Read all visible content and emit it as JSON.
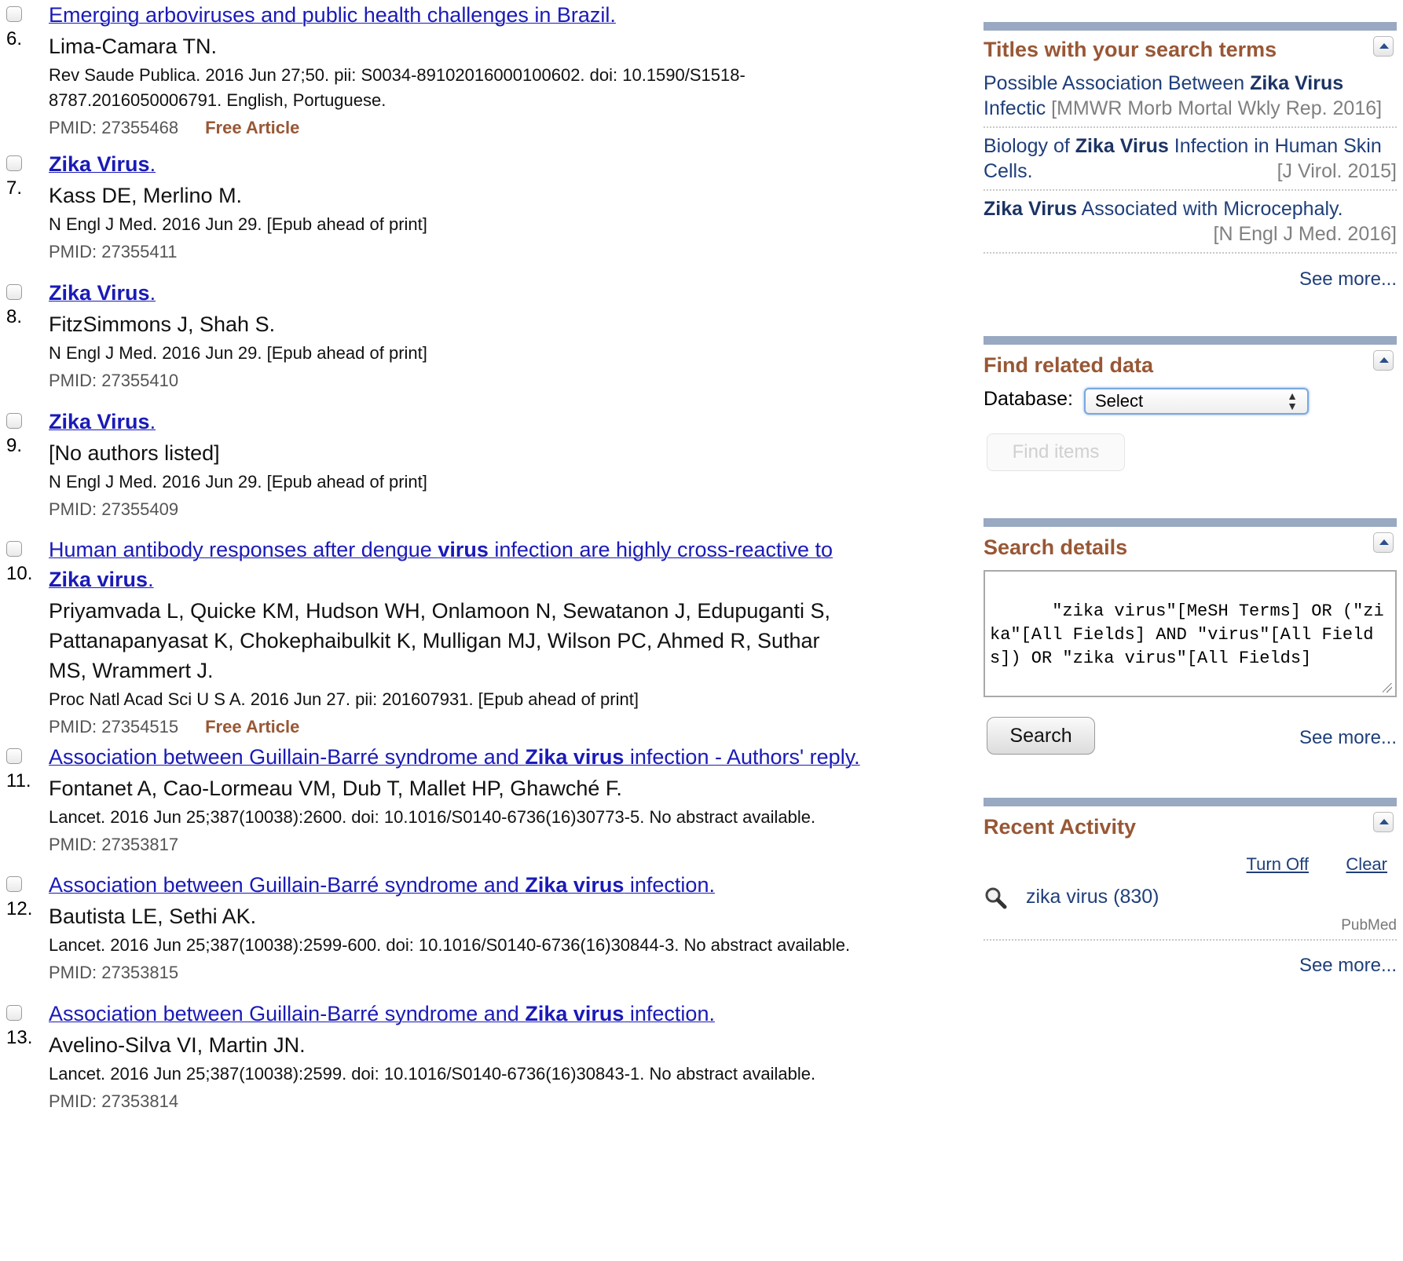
{
  "results": [
    {
      "number": "6.",
      "title_html": "Emerging arboviruses and public health challenges in Brazil.",
      "authors": "Lima-Camara TN.",
      "details": "Rev Saude Publica. 2016 Jun 27;50. pii: S0034-89102016000100602. doi: 10.1590/S1518-8787.2016050006791. English, Portuguese.",
      "pmid": "PMID: 27355468",
      "free": "Free Article"
    },
    {
      "number": "7.",
      "title_html": "<b>Zika Virus</b>.",
      "authors": "Kass DE, Merlino M.",
      "details": "N Engl J Med. 2016 Jun 29. [Epub ahead of print]",
      "pmid": "PMID: 27355411",
      "free": ""
    },
    {
      "number": "8.",
      "title_html": "<b>Zika Virus</b>.",
      "authors": "FitzSimmons J, Shah S.",
      "details": "N Engl J Med. 2016 Jun 29. [Epub ahead of print]",
      "pmid": "PMID: 27355410",
      "free": ""
    },
    {
      "number": "9.",
      "title_html": "<b>Zika Virus</b>.",
      "authors": "[No authors listed]",
      "details": "N Engl J Med. 2016 Jun 29. [Epub ahead of print]",
      "pmid": "PMID: 27355409",
      "free": ""
    },
    {
      "number": "10.",
      "title_html": "Human antibody responses after dengue <b>virus</b> infection are highly cross-reactive to <b>Zika virus</b>.",
      "authors": "Priyamvada L, Quicke KM, Hudson WH, Onlamoon N, Sewatanon J, Edupuganti S, Pattanapanyasat K, Chokephaibulkit K, Mulligan MJ, Wilson PC, Ahmed R, Suthar MS, Wrammert J.",
      "details": "Proc Natl Acad Sci U S A. 2016 Jun 27. pii: 201607931. [Epub ahead of print]",
      "pmid": "PMID: 27354515",
      "free": "Free Article"
    },
    {
      "number": "11.",
      "title_html": "Association between Guillain-Barré syndrome and <b>Zika virus</b> infection - Authors' reply.",
      "authors": "Fontanet A, Cao-Lormeau VM, Dub T, Mallet HP, Ghawché F.",
      "details": "Lancet. 2016 Jun 25;387(10038):2600. doi: 10.1016/S0140-6736(16)30773-5. No abstract available.",
      "pmid": "PMID: 27353817",
      "free": ""
    },
    {
      "number": "12.",
      "title_html": "Association between Guillain-Barré syndrome and <b>Zika virus</b> infection.",
      "authors": "Bautista LE, Sethi AK.",
      "details": "Lancet. 2016 Jun 25;387(10038):2599-600. doi: 10.1016/S0140-6736(16)30844-3. No abstract available.",
      "pmid": "PMID: 27353815",
      "free": ""
    },
    {
      "number": "13.",
      "title_html": "Association between Guillain-Barré syndrome and <b>Zika virus</b> infection.",
      "authors": "Avelino-Silva VI, Martin JN.",
      "details": "Lancet. 2016 Jun 25;387(10038):2599. doi: 10.1016/S0140-6736(16)30843-1. No abstract available.",
      "pmid": "PMID: 27353814",
      "free": ""
    }
  ],
  "sidebar": {
    "titles": {
      "heading": "Titles with your search terms",
      "items": [
        {
          "title_pre": "Possible Association Between ",
          "title_bold": "Zika Virus",
          "title_post": " Infectic",
          "source": "[MMWR Morb Mortal Wkly Rep. 2016]"
        },
        {
          "title_pre": "Biology of ",
          "title_bold": "Zika Virus",
          "title_post": " Infection in Human Skin Cells.",
          "source": "[J Virol. 2015]"
        },
        {
          "title_pre": "",
          "title_bold": "Zika Virus",
          "title_post": " Associated with Microcephaly.",
          "source": "[N Engl J Med. 2016]"
        }
      ],
      "see_more": "See more..."
    },
    "related": {
      "heading": "Find related data",
      "database_label": "Database:",
      "database_value": "Select",
      "find_button": "Find items"
    },
    "search_details": {
      "heading": "Search details",
      "query": "\"zika virus\"[MeSH Terms] OR (\"zika\"[All Fields] AND \"virus\"[All Fields]) OR \"zika virus\"[All Fields]",
      "search_button": "Search",
      "see_more": "See more..."
    },
    "recent": {
      "heading": "Recent Activity",
      "turn_off": "Turn Off",
      "clear": "Clear",
      "item": "zika virus (830)",
      "item_db": "PubMed",
      "see_more": "See more...",
      "item_icon": "magnifier-icon"
    }
  },
  "colors": {
    "link": "#1a1ab8",
    "heading": "#985735",
    "portlet_bar": "#98a9c1",
    "sidebar_link": "#1f3f7a"
  }
}
